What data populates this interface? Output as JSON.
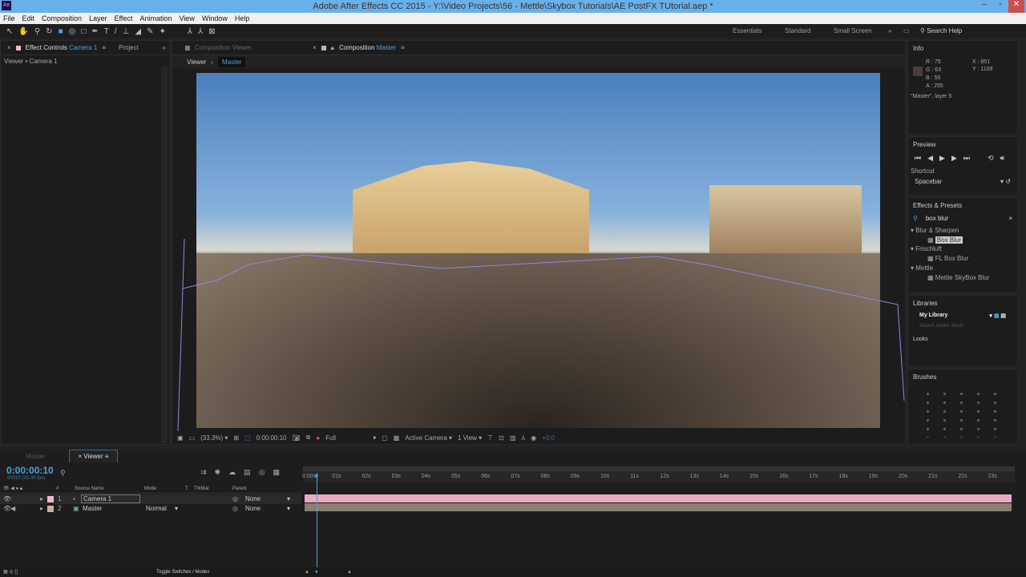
{
  "window": {
    "title": "Adobe After Effects CC 2015 - Y:\\Video Projects\\56 - Mettle\\Skybox Tutorials\\AE PostFX TUtorial.aep *",
    "logo": "Ae"
  },
  "menu": [
    "File",
    "Edit",
    "Composition",
    "Layer",
    "Effect",
    "Animation",
    "View",
    "Window",
    "Help"
  ],
  "toolbar": {
    "tools": [
      "selection-tool",
      "hand-tool",
      "zoom-tool",
      "rotate-tool",
      "camera-tool",
      "pan-behind-tool",
      "rectangle-tool",
      "pen-tool",
      "type-tool",
      "brush-tool",
      "clone-stamp-tool",
      "eraser-tool",
      "roto-brush-tool",
      "puppet-pin-tool",
      "local-axis",
      "world-axis",
      "view-axis"
    ],
    "workspaces": [
      "Essentials",
      "Standard",
      "Small Screen"
    ],
    "more": "»",
    "search_help": "Search Help"
  },
  "left_panel": {
    "tab1": "Effect Controls",
    "tab1_target": "Camera 1",
    "tab2": "Project",
    "more": "»",
    "subtitle": "Viewer • Camera 1"
  },
  "comp_panel": {
    "tab1": "Composition Viewer",
    "tab2": "Composition",
    "tab2_target": "Master",
    "crumb1": "Viewer",
    "crumb2": "Master",
    "footer": {
      "zoom": "(33.3%)",
      "timecode": "0:00:00:10",
      "resolution": "Full",
      "camera": "Active Camera",
      "views": "1 View",
      "exposure": "+0.0"
    }
  },
  "info": {
    "title": "Info",
    "r": "R : 75",
    "g": "G : 63",
    "b": "B : 55",
    "a": "A : 255",
    "x": "X : 851",
    "y": "Y : 1109",
    "layer": "\"Master\", layer 5"
  },
  "preview": {
    "title": "Preview",
    "shortcut_label": "Shortcut",
    "shortcut_value": "Spacebar"
  },
  "effects": {
    "title": "Effects & Presets",
    "search": "box blur",
    "groups": [
      {
        "name": "Blur & Sharpen",
        "items": [
          "Box Blur"
        ]
      },
      {
        "name": "Frischluft",
        "items": [
          "FL Box Blur"
        ]
      },
      {
        "name": "Mettle",
        "items": [
          "Mettle SkyBox Blur"
        ]
      }
    ]
  },
  "libraries": {
    "title": "Libraries",
    "library": "My Library",
    "search_placeholder": "Search Adobe Stock",
    "looks": "Looks"
  },
  "brushes": {
    "title": "Brushes"
  },
  "timeline": {
    "tabs": [
      "Master",
      "Viewer"
    ],
    "timecode": "0:00:00:10",
    "fps": "00010 (25.00 fps)",
    "columns": {
      "num": "#",
      "source": "Source Name",
      "mode": "Mode",
      "t": "T",
      "trkmat": "TrkMat",
      "parent": "Parent"
    },
    "layers": [
      {
        "num": "1",
        "name": "Camera 1",
        "mode": "",
        "parent": "None",
        "color": "#f0b8cf"
      },
      {
        "num": "2",
        "name": "Master",
        "mode": "Normal",
        "parent": "None",
        "color": "#c8b49c"
      }
    ],
    "ruler": [
      "0:00s",
      "01s",
      "02s",
      "03s",
      "04s",
      "05s",
      "06s",
      "07s",
      "08s",
      "09s",
      "10s",
      "11s",
      "12s",
      "13s",
      "14s",
      "15s",
      "16s",
      "17s",
      "18s",
      "19s",
      "20s",
      "21s",
      "22s",
      "23s"
    ],
    "toggle": "Toggle Switches / Modes"
  },
  "colors": {
    "accent": "#4aa3df",
    "camera_bar": "#e9a9c3",
    "footage_bar": "#8a7f72"
  }
}
